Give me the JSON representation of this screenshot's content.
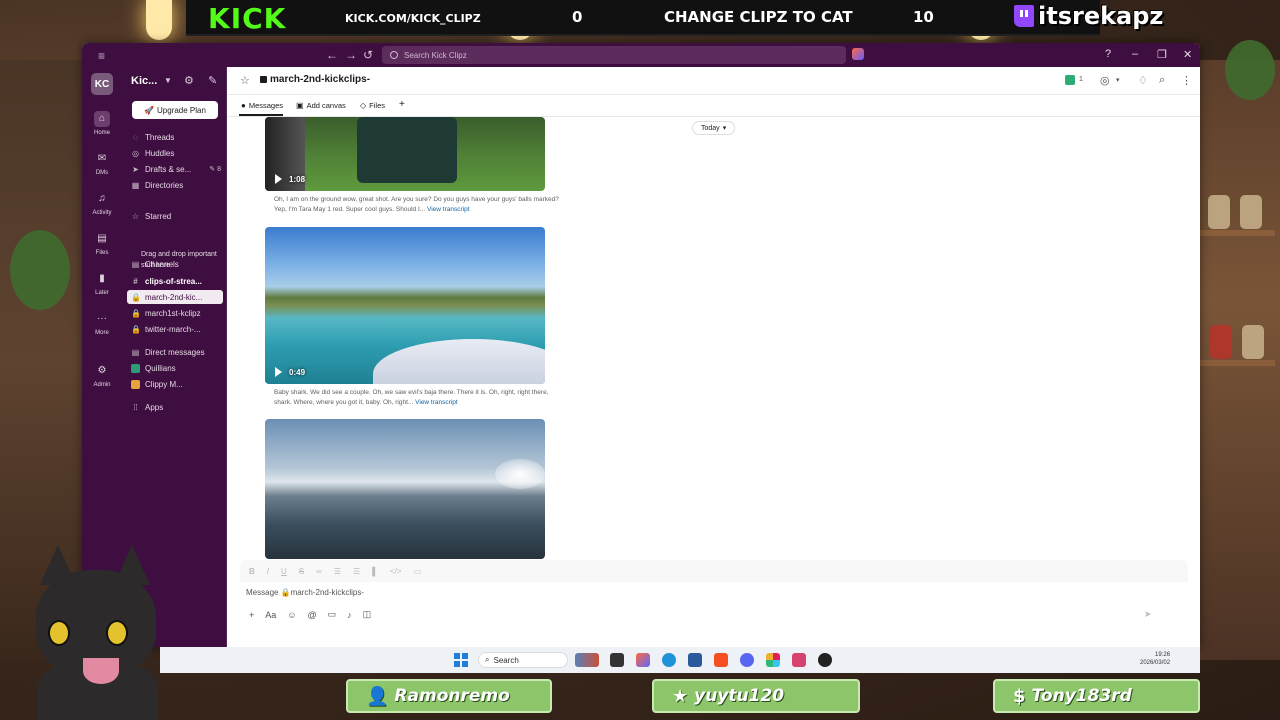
{
  "stream": {
    "kick_logo": "KICK",
    "kick_url": "KICK.COM/KICK_CLIPZ",
    "score_left": "0",
    "goal_text": "CHANGE CLIPZ TO CAT",
    "score_right": "10",
    "twitch_name": "itsrekapz",
    "tags": [
      "Ramonremo",
      "yuytu120",
      "Tony183rd"
    ]
  },
  "titlebar": {
    "search_placeholder": "Search Kick Clipz",
    "back": "←",
    "forward": "→",
    "history": "↺",
    "help": "?",
    "minimize": "–",
    "maximize": "❐",
    "close": "✕"
  },
  "rail": {
    "workspace_initials": "KC",
    "items": [
      "Home",
      "DMs",
      "Activity",
      "Files",
      "Later",
      "More",
      "Admin"
    ]
  },
  "sidebar": {
    "workspace_name": "Kic...",
    "upgrade_label": "Upgrade Plan",
    "threads": "Threads",
    "huddles": "Huddles",
    "drafts": "Drafts & se...",
    "drafts_count": "8",
    "directories": "Directories",
    "starred": "Starred",
    "starred_hint": "Drag and drop important stuff here",
    "channels_header": "Channels",
    "channels": [
      "clips-of-strea...",
      "march-2nd-kic...",
      "march1st-kclipz",
      "twitter-march-..."
    ],
    "dm_header": "Direct messages",
    "dms": [
      "Quillians",
      "Clippy M..."
    ],
    "apps": "Apps"
  },
  "channel": {
    "name": "march-2nd-kickclips-",
    "member_count": "1",
    "tabs": [
      "Messages",
      "Add canvas",
      "Files",
      "+"
    ],
    "date_divider": "Today"
  },
  "messages": [
    {
      "duration": "1:08",
      "transcript": "Oh, I am on the ground wow, great shot. Are you sure? Do you guys have your guys' balls marked? Yep, I'm Tara May 1 red. Super cool guys. Should I...",
      "link": "View transcript"
    },
    {
      "duration": "0:49",
      "transcript": "Baby shark. We did see a couple. Oh, we saw evil's baja there. There it is. Oh, right, right there, shark. Where, where you got it, baby. Oh, right...",
      "link": "View transcript"
    },
    {
      "duration": "",
      "transcript": "",
      "link": ""
    }
  ],
  "composer": {
    "placeholder": "Message 🔒march-2nd-kickclips-"
  },
  "taskbar": {
    "search_label": "Search",
    "time": "19:26",
    "date": "2026/03/02"
  }
}
